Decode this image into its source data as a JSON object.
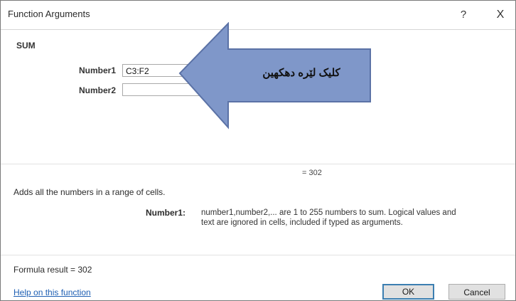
{
  "window": {
    "title": "Function Arguments",
    "help_label": "?",
    "close_label": "X"
  },
  "function": {
    "name": "SUM",
    "args": [
      {
        "label": "Number1",
        "value": "C3:F2"
      },
      {
        "label": "Number2",
        "value": ""
      }
    ]
  },
  "callout": {
    "text": "کلیک لێره دهکهین"
  },
  "result_preview": "= 302",
  "description": "Adds all the numbers in a range of cells.",
  "arg_help": {
    "label": "Number1:",
    "text": "number1,number2,... are 1 to 255 numbers to sum. Logical values and\ntext are ignored in cells, included if typed as arguments."
  },
  "formula_result": "Formula result = 302",
  "help_link": "Help on this function",
  "buttons": {
    "ok": "OK",
    "cancel": "Cancel"
  },
  "colors": {
    "arrow_fill": "#7f97c9",
    "arrow_stroke": "#5b72a6",
    "link": "#1e5fb3",
    "ok_border": "#3c7fb1"
  }
}
